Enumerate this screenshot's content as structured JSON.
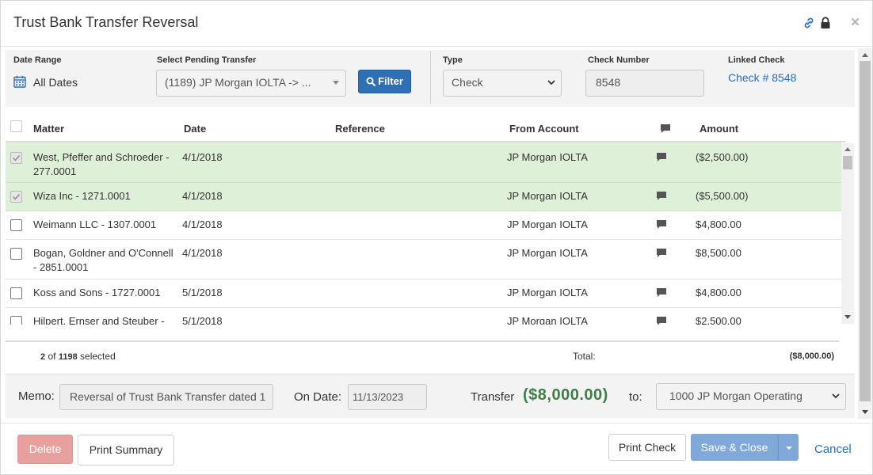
{
  "header": {
    "title": "Trust Bank Transfer Reversal"
  },
  "filters": {
    "date_range_label": "Date Range",
    "date_range_value": "All Dates",
    "pending_label": "Select Pending Transfer",
    "pending_value": "(1189) JP Morgan IOLTA -> ...",
    "filter_button": "Filter",
    "type_label": "Type",
    "type_value": "Check",
    "check_number_label": "Check Number",
    "check_number_value": "8548",
    "linked_check_label": "Linked Check",
    "linked_check_value": "Check # 8548"
  },
  "table": {
    "columns": {
      "matter": "Matter",
      "date": "Date",
      "reference": "Reference",
      "from_account": "From Account",
      "amount": "Amount"
    },
    "rows": [
      {
        "matter": "West, Pfeffer and Schroeder - 277.0001",
        "date": "4/1/2018",
        "reference": "",
        "from_account": "JP Morgan IOLTA",
        "amount": "($2,500.00)",
        "selected": true
      },
      {
        "matter": "Wiza Inc - 1271.0001",
        "date": "4/1/2018",
        "reference": "",
        "from_account": "JP Morgan IOLTA",
        "amount": "($5,500.00)",
        "selected": true
      },
      {
        "matter": "Weimann LLC - 1307.0001",
        "date": "4/1/2018",
        "reference": "",
        "from_account": "JP Morgan IOLTA",
        "amount": "$4,800.00",
        "selected": false
      },
      {
        "matter": "Bogan, Goldner and O'Connell - 2851.0001",
        "date": "4/1/2018",
        "reference": "",
        "from_account": "JP Morgan IOLTA",
        "amount": "$8,500.00",
        "selected": false
      },
      {
        "matter": "Koss and Sons - 1727.0001",
        "date": "5/1/2018",
        "reference": "",
        "from_account": "JP Morgan IOLTA",
        "amount": "$4,800.00",
        "selected": false
      },
      {
        "matter": "Hilpert, Ernser and Steuber -",
        "date": "5/1/2018",
        "reference": "",
        "from_account": "JP Morgan IOLTA",
        "amount": "$2,500.00",
        "selected": false
      }
    ]
  },
  "summary": {
    "selected_count": "2",
    "of_word": "of",
    "total_count": "1198",
    "selected_word": "selected",
    "total_label": "Total:",
    "total_value": "($8,000.00)"
  },
  "memo": {
    "memo_label": "Memo:",
    "memo_value": "Reversal of Trust Bank Transfer dated 1",
    "on_date_label": "On Date:",
    "on_date_value": "11/13/2023",
    "transfer_label": "Transfer",
    "transfer_amount": "($8,000.00)",
    "to_label": "to:",
    "to_account": "1000 JP Morgan Operating"
  },
  "footer": {
    "delete": "Delete",
    "print_summary": "Print Summary",
    "print_check": "Print Check",
    "save_close": "Save & Close",
    "cancel": "Cancel"
  },
  "colors": {
    "accent": "#2f70b5",
    "selected_row": "#dff0d8",
    "transfer_green": "#3d7f45",
    "delete": "#e8a09f",
    "save": "#80a8d8",
    "link": "#2a6ebb"
  }
}
